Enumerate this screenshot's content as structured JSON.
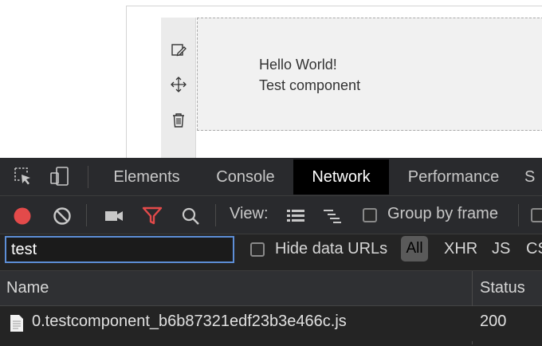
{
  "component": {
    "line1": "Hello World!",
    "line2": "Test component"
  },
  "component_toolbar": {
    "icons": [
      "edit-icon",
      "move-icon",
      "delete-icon"
    ]
  },
  "devtools": {
    "tabs": [
      {
        "label": "Elements",
        "active": false
      },
      {
        "label": "Console",
        "active": false
      },
      {
        "label": "Network",
        "active": true
      },
      {
        "label": "Performance",
        "active": false
      },
      {
        "label": "S",
        "active": false
      }
    ],
    "toolbar": {
      "view_label": "View:",
      "group_by_frame_label": "Group by frame",
      "group_by_frame_checked": false,
      "record_color": "#e34a4a",
      "filter_color": "#e34a4a"
    },
    "filter": {
      "value": "test",
      "hide_data_urls_label": "Hide data URLs",
      "hide_data_urls_checked": false,
      "type_filters": [
        "All",
        "XHR",
        "JS",
        "CS"
      ],
      "selected_type": "All"
    },
    "table": {
      "columns": [
        "Name",
        "Status"
      ],
      "rows": [
        {
          "name": "0.testcomponent_b6b87321edf23b3e466c.js",
          "status": "200"
        }
      ]
    }
  }
}
